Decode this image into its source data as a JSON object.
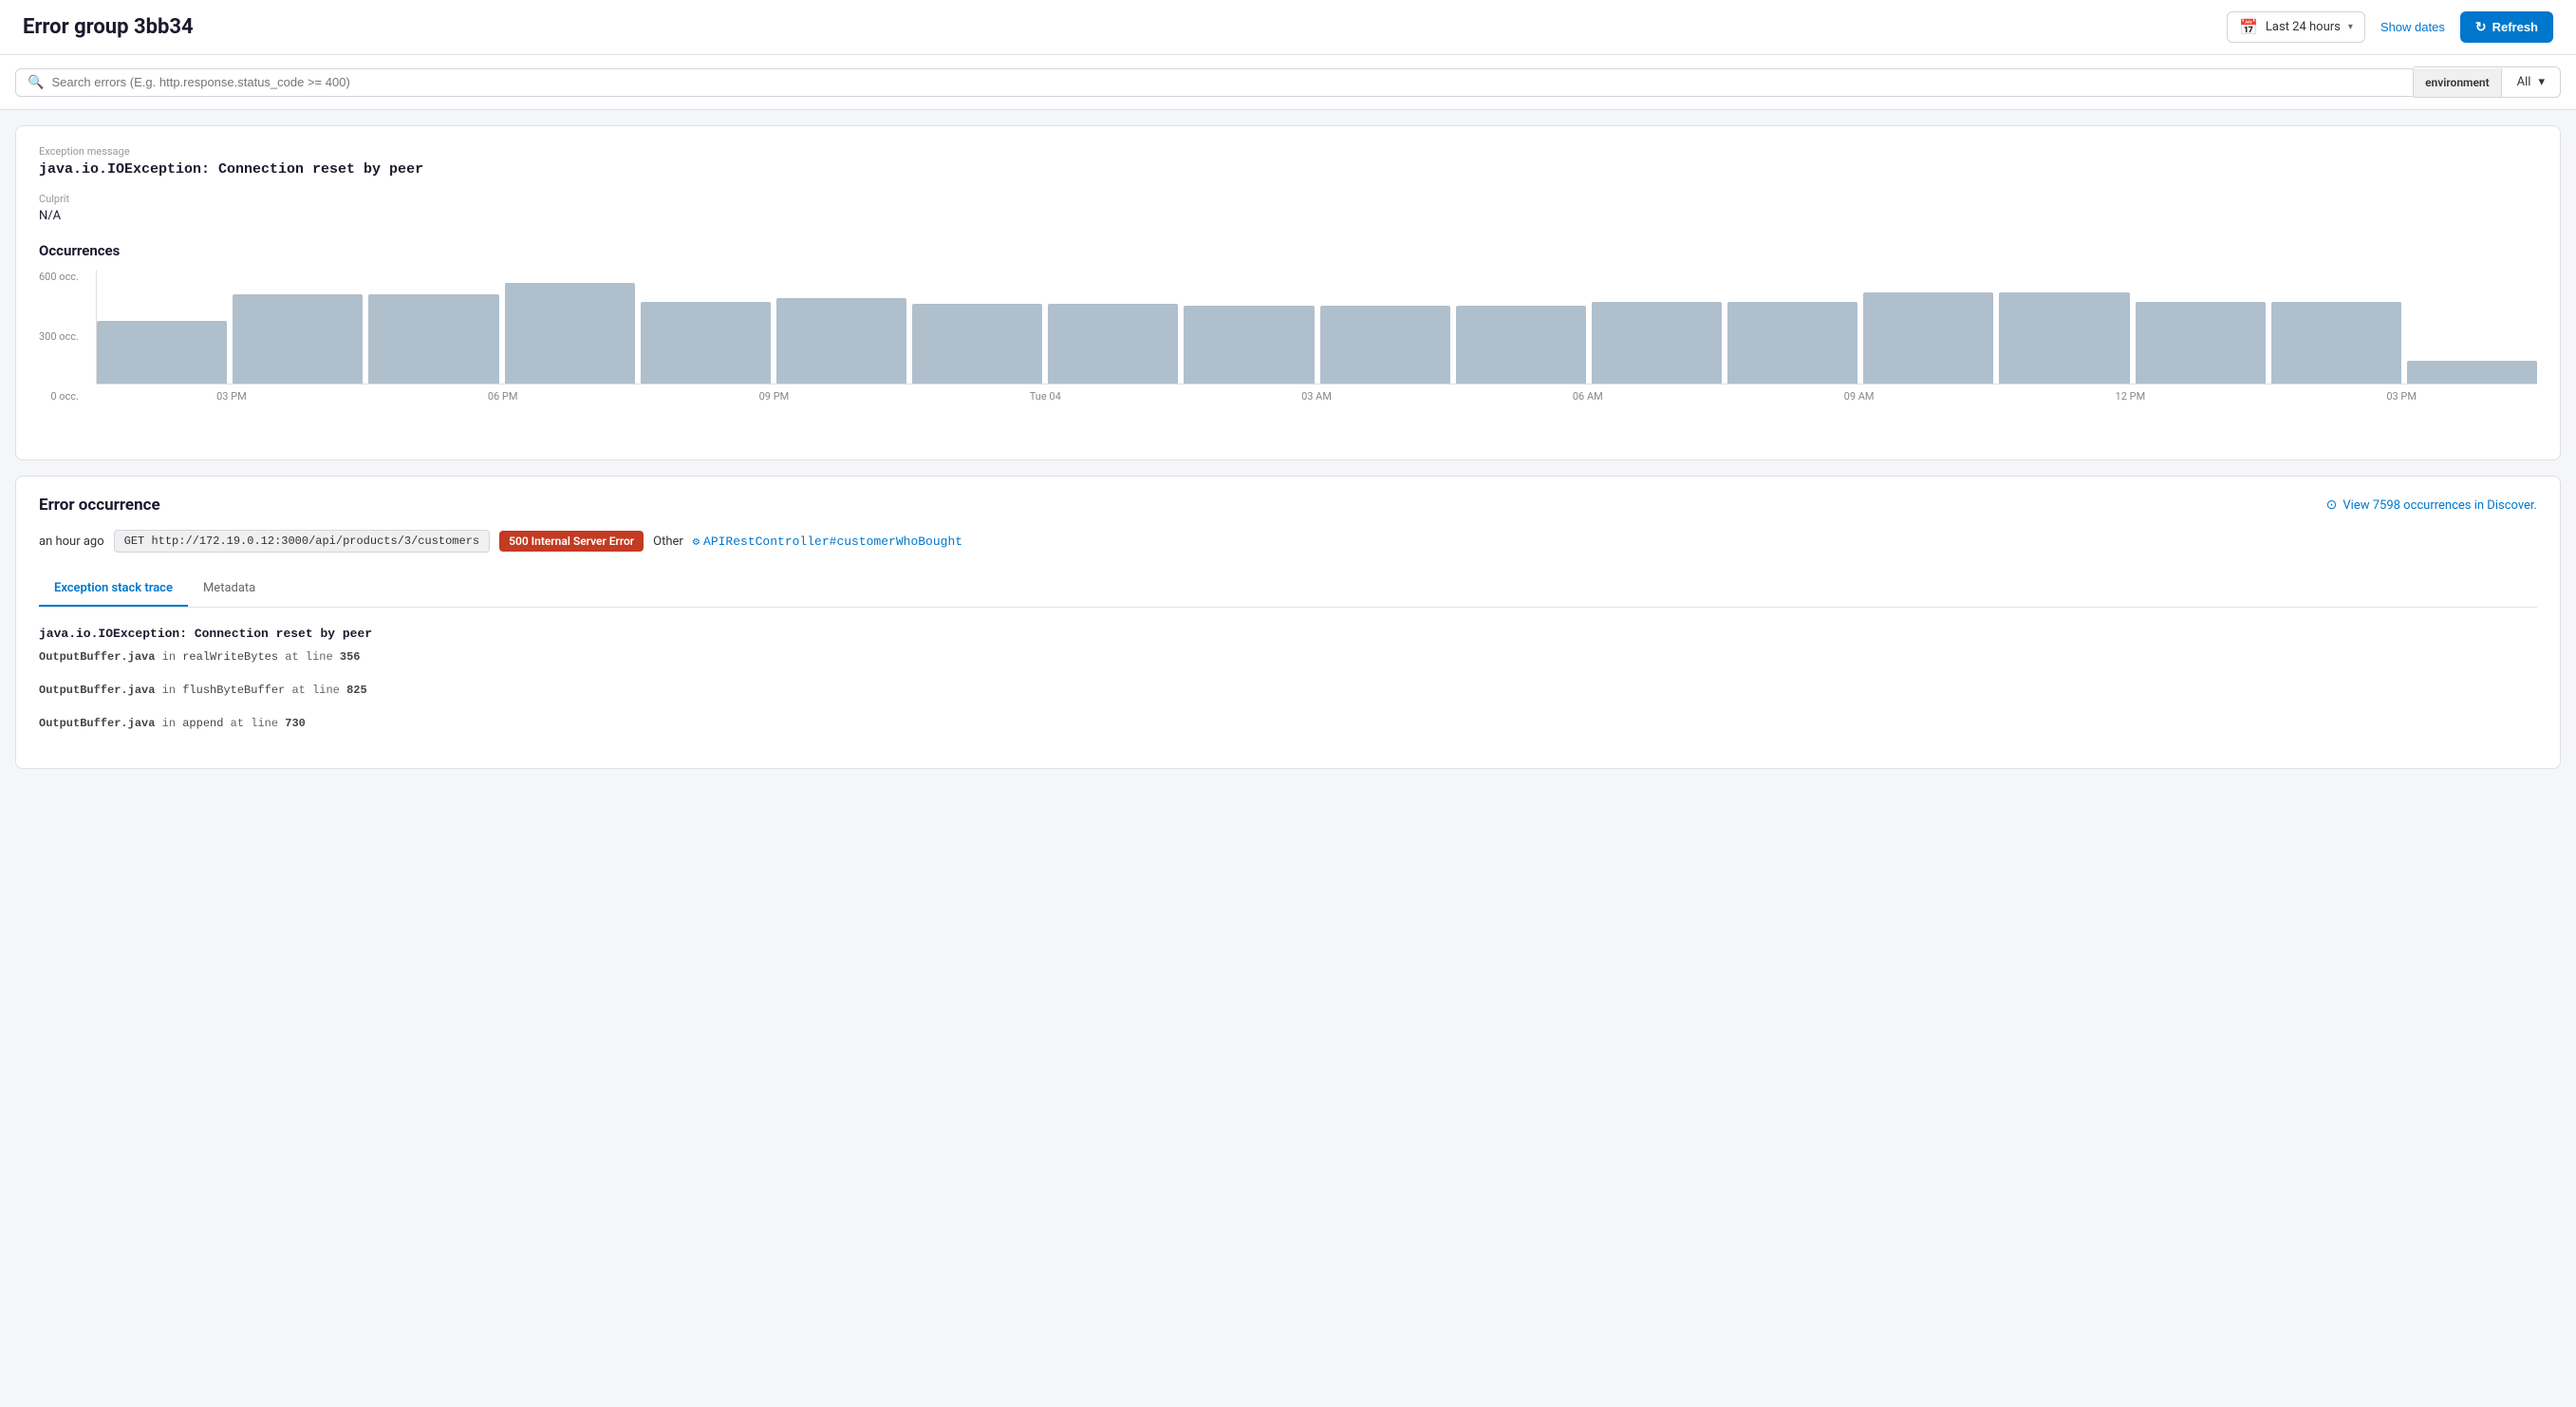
{
  "header": {
    "title": "Error group 3bb34",
    "time_picker_label": "Last 24 hours",
    "show_dates_label": "Show dates",
    "refresh_label": "Refresh"
  },
  "search": {
    "placeholder": "Search errors (E.g. http.response.status_code >= 400)"
  },
  "environment_filter": {
    "label": "environment",
    "selected": "All"
  },
  "exception_info": {
    "message_label": "Exception message",
    "message_value": "java.io.IOException: Connection reset by peer",
    "culprit_label": "Culprit",
    "culprit_value": "N/A",
    "occurrences_title": "Occurrences",
    "y_labels": [
      "600 occ.",
      "300 occ.",
      "0 occ."
    ],
    "x_labels": [
      "03 PM",
      "06 PM",
      "09 PM",
      "Tue 04",
      "03 AM",
      "06 AM",
      "09 AM",
      "12 PM",
      "03 PM"
    ],
    "bars": [
      {
        "height_pct": 55
      },
      {
        "height_pct": 78
      },
      {
        "height_pct": 78
      },
      {
        "height_pct": 88
      },
      {
        "height_pct": 72
      },
      {
        "height_pct": 75
      },
      {
        "height_pct": 70
      },
      {
        "height_pct": 70
      },
      {
        "height_pct": 68
      },
      {
        "height_pct": 68
      },
      {
        "height_pct": 68
      },
      {
        "height_pct": 72
      },
      {
        "height_pct": 72
      },
      {
        "height_pct": 80
      },
      {
        "height_pct": 80
      },
      {
        "height_pct": 72
      },
      {
        "height_pct": 72
      },
      {
        "height_pct": 20
      }
    ]
  },
  "error_occurrence": {
    "title": "Error occurrence",
    "view_discover_label": "View 7598 occurrences in Discover.",
    "time_ago": "an hour ago",
    "request": "GET http://172.19.0.12:3000/api/products/3/customers",
    "error_badge": "500 Internal Server Error",
    "other_label": "Other",
    "controller": "APIRestController#customerWhoBought",
    "tabs": [
      {
        "label": "Exception stack trace",
        "active": true
      },
      {
        "label": "Metadata",
        "active": false
      }
    ],
    "stack_trace": {
      "exception_title": "java.io.IOException: Connection reset by peer",
      "lines": [
        {
          "file": "OutputBuffer.java",
          "in": "in",
          "method": "realWriteBytes",
          "at": "at line",
          "line": "356"
        },
        {
          "file": "OutputBuffer.java",
          "in": "in",
          "method": "flushByteBuffer",
          "at": "at line",
          "line": "825"
        },
        {
          "file": "OutputBuffer.java",
          "in": "in",
          "method": "append",
          "at": "at line",
          "line": "730"
        }
      ]
    }
  }
}
